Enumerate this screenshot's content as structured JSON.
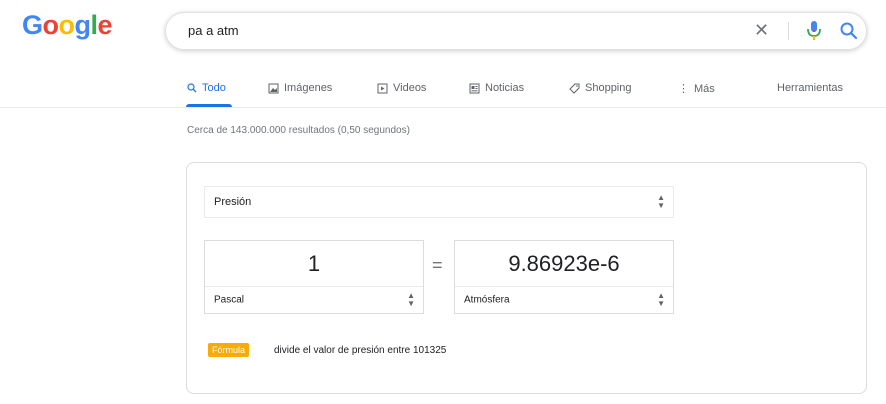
{
  "logo": {
    "letters": [
      "G",
      "o",
      "o",
      "g",
      "l",
      "e"
    ],
    "colors": [
      "#4285f4",
      "#ea4335",
      "#fbbc05",
      "#4285f4",
      "#34a853",
      "#ea4335"
    ]
  },
  "search": {
    "query": "pa a atm",
    "clear_icon": "close-icon",
    "mic_icon": "mic-icon",
    "search_icon": "search-icon"
  },
  "tabs": [
    {
      "label": "Todo",
      "icon": "search-icon",
      "active": true
    },
    {
      "label": "Imágenes",
      "icon": "image-icon"
    },
    {
      "label": "Videos",
      "icon": "video-icon"
    },
    {
      "label": "Noticias",
      "icon": "news-icon"
    },
    {
      "label": "Shopping",
      "icon": "tag-icon"
    },
    {
      "label": "Más",
      "icon": "more-vert-icon"
    },
    {
      "label": "Herramientas"
    }
  ],
  "stats": "Cerca de 143.000.000 resultados (0,50 segundos)",
  "converter": {
    "category": "Presión",
    "from": {
      "value": "1",
      "unit": "Pascal"
    },
    "equals": "=",
    "to": {
      "value": "9.86923e-6",
      "unit": "Atmósfera"
    },
    "formula_badge": "Fórmula",
    "formula_text": "divide el valor de presión entre 101325"
  },
  "accent_color": "#1a73e8"
}
